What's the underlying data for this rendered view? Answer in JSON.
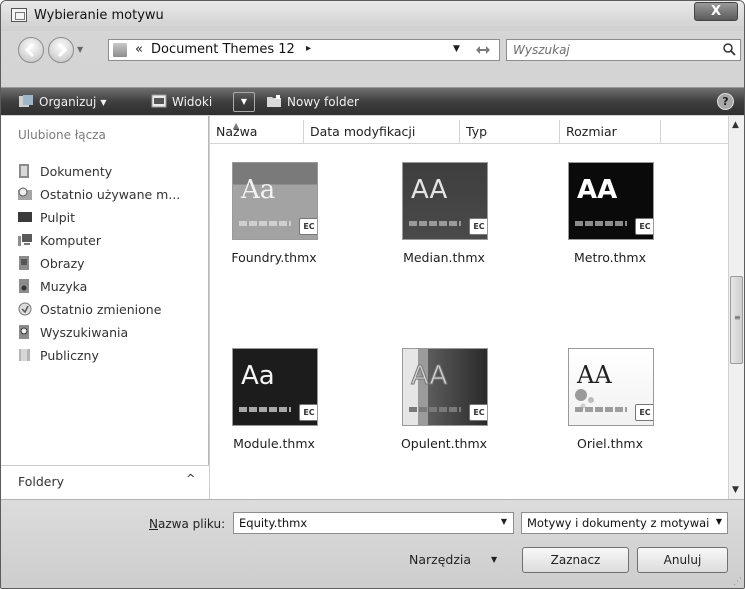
{
  "window": {
    "title": "Wybieranie motywu",
    "close_glyph": "X"
  },
  "address": {
    "chevron": "«",
    "path": "Document Themes 12",
    "separator": "▸",
    "search_placeholder": "Wyszukaj"
  },
  "toolbar": {
    "organize": "Organizuj",
    "views": "Widoki",
    "new_folder": "Nowy folder",
    "help_glyph": "?"
  },
  "sidebar": {
    "header": "Ulubione łącza",
    "items": [
      {
        "label": "Dokumenty",
        "icon": "documents-icon"
      },
      {
        "label": "Ostatnio używane m...",
        "icon": "recent-places-icon"
      },
      {
        "label": "Pulpit",
        "icon": "desktop-icon"
      },
      {
        "label": "Komputer",
        "icon": "computer-icon"
      },
      {
        "label": "Obrazy",
        "icon": "pictures-icon"
      },
      {
        "label": "Muzyka",
        "icon": "music-icon"
      },
      {
        "label": "Ostatnio zmienione",
        "icon": "recently-changed-icon"
      },
      {
        "label": "Wyszukiwania",
        "icon": "searches-icon"
      },
      {
        "label": "Publiczny",
        "icon": "public-folder-icon"
      }
    ],
    "footer_label": "Foldery",
    "footer_toggle": "^"
  },
  "columns": [
    "Nazwa",
    "Data modyfikacji",
    "Typ",
    "Rozmiar"
  ],
  "files": [
    {
      "name": "Foundry.thmx",
      "thumb_text": "Aa"
    },
    {
      "name": "Median.thmx",
      "thumb_text": "AA"
    },
    {
      "name": "Metro.thmx",
      "thumb_text": "AA"
    },
    {
      "name": "Module.thmx",
      "thumb_text": "Aa"
    },
    {
      "name": "Opulent.thmx",
      "thumb_text": "AA"
    },
    {
      "name": "Oriel.thmx",
      "thumb_text": "AA"
    }
  ],
  "badge_text": "EC",
  "bottom": {
    "filename_label_underlined": "N",
    "filename_label_rest": "azwa pliku:",
    "filename_value": "Equity.thmx",
    "filetype_value": "Motywy i dokumenty z motywai",
    "tools_label": "Narzędzia",
    "ok_label": "Zaznacz",
    "cancel_label": "Anuluj"
  }
}
